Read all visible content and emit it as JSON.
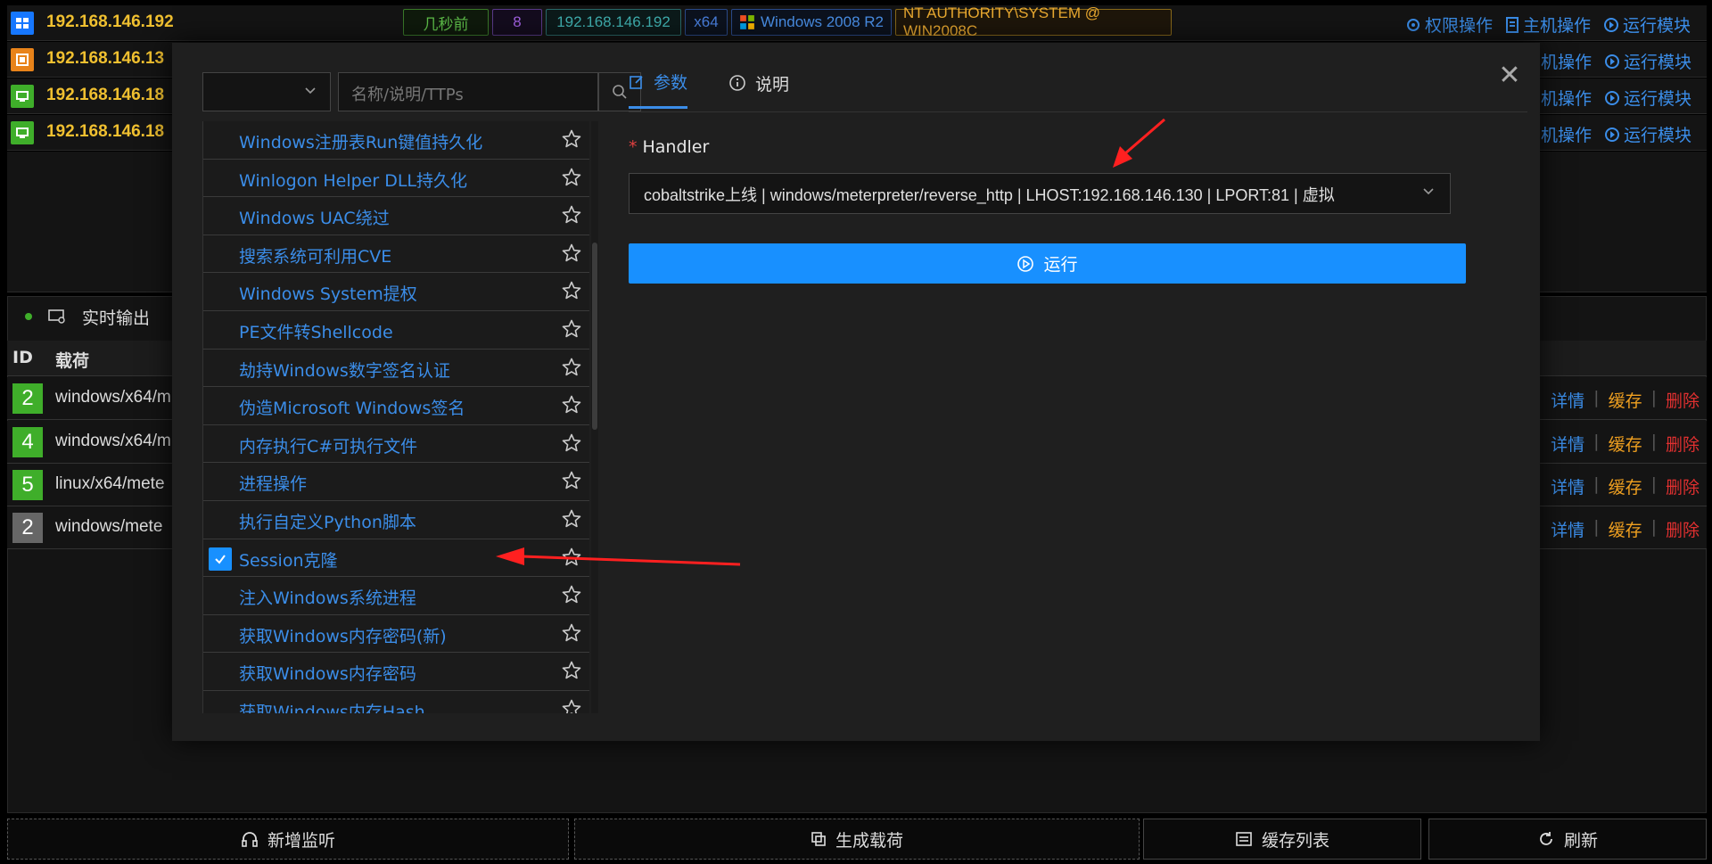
{
  "hosts": [
    {
      "ip": "192.168.146.192",
      "icon": "windows-session-icon",
      "icon_color": "#1677ff"
    },
    {
      "ip": "192.168.146.13",
      "icon": "linux-session-icon",
      "icon_color": "#e8831a"
    },
    {
      "ip": "192.168.146.18",
      "icon": "monitor-session-icon",
      "icon_color": "#3fae2a"
    },
    {
      "ip": "192.168.146.18",
      "icon": "monitor-session-icon",
      "icon_color": "#3fae2a"
    }
  ],
  "host_tags": {
    "time": "几秒前",
    "pid": "8",
    "ip": "192.168.146.192",
    "arch": "x64",
    "os": "Windows 2008 R2",
    "user": "NT AUTHORITY\\SYSTEM @ WIN2008C"
  },
  "host_ops": {
    "privilege": "权限操作",
    "host": "主机操作",
    "run_module": "运行模块",
    "host_short": "机操作"
  },
  "output": {
    "label": "实时输出"
  },
  "table": {
    "col_id": "ID",
    "col_payload": "载荷",
    "rows": [
      {
        "id": "2",
        "payload": "windows/x64/m",
        "color": "#3fae2a"
      },
      {
        "id": "4",
        "payload": "windows/x64/m",
        "color": "#3fae2a"
      },
      {
        "id": "5",
        "payload": "linux/x64/mete",
        "color": "#3fae2a"
      },
      {
        "id": "2",
        "payload": "windows/mete",
        "color": "#666666"
      }
    ],
    "action_detail": "详情",
    "action_cache": "缓存",
    "action_delete": "删除"
  },
  "bottom": {
    "add_listener": "新增监听",
    "gen_payload": "生成载荷",
    "cache_list": "缓存列表",
    "refresh": "刷新"
  },
  "modal": {
    "search_placeholder": "名称/说明/TTPs",
    "tab_params": "参数",
    "tab_desc": "说明",
    "handler_label": "Handler",
    "handler_value": "cobaltstrike上线 | windows/meterpreter/reverse_http | LHOST:192.168.146.130 | LPORT:81 | 虚拟",
    "run_label": "运行",
    "modules": [
      "Windows注册表Run键值持久化",
      "Winlogon Helper DLL持久化",
      "Windows UAC绕过",
      "搜索系统可利用CVE",
      "Windows System提权",
      "PE文件转Shellcode",
      "劫持Windows数字签名认证",
      "伪造Microsoft Windows签名",
      "内存执行C#可执行文件",
      "进程操作",
      "执行自定义Python脚本",
      "Session克隆",
      "注入Windows系统进程",
      "获取Windows内存密码(新)",
      "获取Windows内存密码",
      "获取Windows内存Hash"
    ],
    "selected_index": 11
  },
  "colors": {
    "accent": "#1890ff",
    "link": "#3b8de8",
    "ip": "#f0c030",
    "cache": "#f0a020",
    "delete": "#e03030"
  }
}
